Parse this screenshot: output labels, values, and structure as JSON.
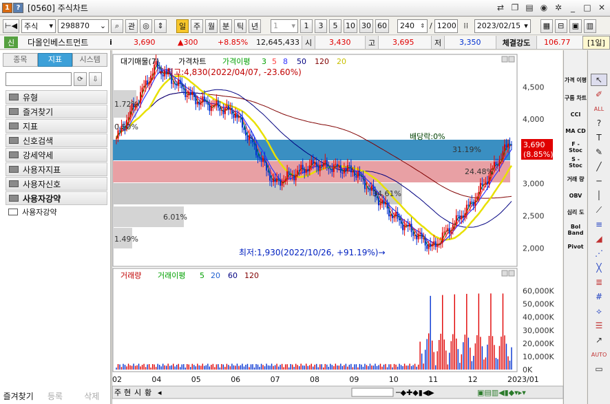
{
  "window": {
    "badge1": "1",
    "badge2": "?",
    "title": "[0560] 주식차트"
  },
  "toolbar": {
    "market": "주식",
    "code": "298870",
    "btn_relation": "관",
    "period_buttons": [
      "일",
      "주",
      "월",
      "분",
      "틱",
      "년"
    ],
    "period_selected": "일",
    "interval_value": "1",
    "interval_buttons": [
      "1",
      "3",
      "5",
      "10",
      "30",
      "60"
    ],
    "count": "240",
    "slash": "/",
    "total": "1200",
    "date": "2023/02/15"
  },
  "quote": {
    "credit": "신",
    "name": "다올인베스트먼트",
    "info": "i",
    "price": "3,690",
    "change": "▲300",
    "change_pct": "+8.85%",
    "volume": "12,645,433",
    "open_label": "시",
    "open": "3,430",
    "high_label": "고",
    "high": "3,695",
    "low_label": "저",
    "low": "3,350",
    "strength_label": "체결강도",
    "strength": "106.77",
    "day_view": "[1일]"
  },
  "left_panel": {
    "tabs": [
      "종목",
      "지표",
      "시스템"
    ],
    "tab_selected": "지표",
    "folders": [
      "유형",
      "즐겨찾기",
      "지표",
      "신호검색",
      "강세약세",
      "사용자지표",
      "사용자신호",
      "사용자강약"
    ],
    "open_folder": "사용자강약",
    "subfolders": [
      "사용자강약"
    ],
    "bottom_buttons": [
      "즐겨찾기",
      "등록",
      "삭제"
    ]
  },
  "chart_legend": {
    "price": [
      "대기매물(7)",
      "가격차트",
      "가격이평",
      "3",
      "5",
      "8",
      "50",
      "120",
      "20"
    ],
    "volume": [
      "거래량",
      "거래이평",
      "5",
      "20",
      "60",
      "120"
    ]
  },
  "annotations": {
    "high_note": "←최고:4,830(2022/04/07, -23.60%)",
    "low_note": "최저:1,930(2022/10/26, +91.19%)→",
    "dividend": "배당락:0%",
    "pct_labels": [
      "1.72%",
      "0.50%",
      "31.19%",
      "24.48%",
      "34.61%",
      "6.01%",
      "1.49%"
    ],
    "price_flag": "3,690",
    "price_flag_pct": "(8.85%)"
  },
  "right_indicators": [
    "가격\n이평",
    "구름\n차트",
    "CCI",
    "MA\nCD",
    "F -\nStoc",
    "S -\nStoc",
    "거래\n량",
    "OBV",
    "심리\n도",
    "Bol\nBand",
    "Pivot"
  ],
  "bottom_bar": {
    "tabs": [
      "주",
      "현",
      "시",
      "황"
    ]
  },
  "colors": {
    "up": "#e00000",
    "down": "#0030d0",
    "ma3": "#00a000",
    "ma5": "#ff4040",
    "ma8": "#3030ff",
    "ma50": "#000080",
    "ma120": "#800000",
    "ma20": "#e8e000",
    "band_blue": "#3a8fc2",
    "band_pink": "#e8a0a4",
    "band_gray": "#c8c8c8"
  },
  "chart_data": [
    {
      "type": "line",
      "title": "가격차트",
      "x": [
        "02",
        "04",
        "05",
        "06",
        "07",
        "08",
        "09",
        "10",
        "11",
        "12",
        "2023/01"
      ],
      "ylabel": "",
      "yticks": [
        2000,
        2500,
        3000,
        3500,
        4000,
        4500
      ],
      "ylim": [
        1800,
        4900
      ],
      "series": [
        {
          "name": "가격차트",
          "values": [
            3700,
            4830,
            4300,
            4100,
            3000,
            3300,
            3200,
            2500,
            2000,
            2700,
            3690
          ]
        }
      ],
      "volume_profile_pct": [
        1.72,
        0.5,
        31.19,
        34.61,
        24.48,
        6.01,
        1.49
      ]
    },
    {
      "type": "bar",
      "title": "거래량",
      "yticks": [
        "0K",
        "10,000K",
        "20,000K",
        "30,000K",
        "40,000K",
        "50,000K",
        "60,000K"
      ],
      "ylim": [
        0,
        65000
      ]
    }
  ]
}
